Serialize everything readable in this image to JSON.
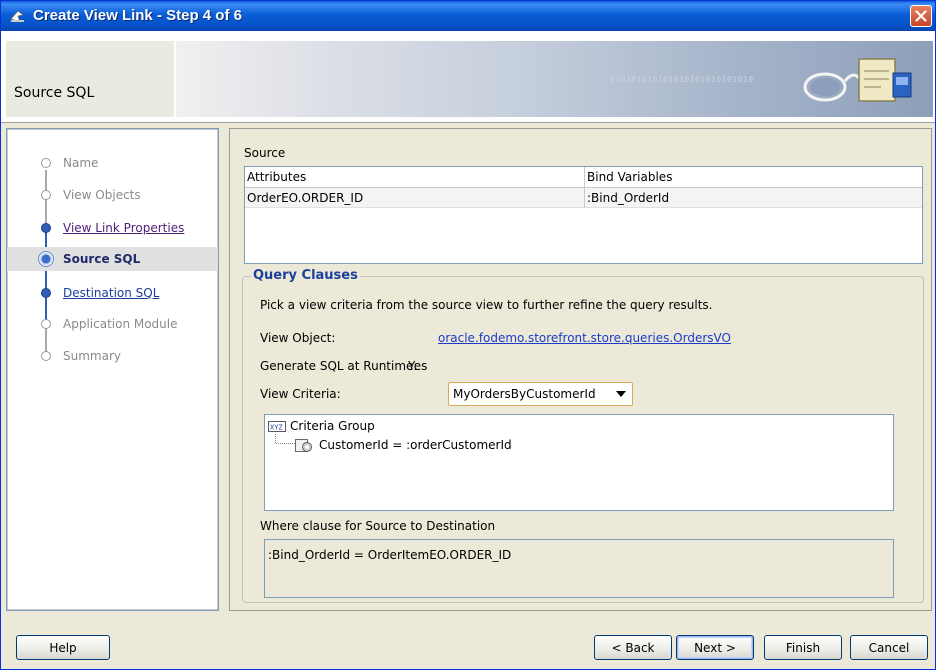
{
  "window": {
    "title": "Create View Link - Step 4 of 6"
  },
  "header": {
    "page_title": "Source SQL",
    "banner_digits": "010101010101010101010101010"
  },
  "steps": [
    {
      "label": "Name",
      "state": "future"
    },
    {
      "label": "View Objects",
      "state": "future"
    },
    {
      "label": "View Link Properties",
      "state": "done"
    },
    {
      "label": "Source SQL",
      "state": "current"
    },
    {
      "label": "Destination SQL",
      "state": "next"
    },
    {
      "label": "Application Module",
      "state": "future"
    },
    {
      "label": "Summary",
      "state": "future"
    }
  ],
  "source": {
    "label": "Source",
    "columns": [
      "Attributes",
      "Bind Variables"
    ],
    "rows": [
      {
        "attribute": "OrderEO.ORDER_ID",
        "bind_variable": ":Bind_OrderId"
      }
    ]
  },
  "query_clauses": {
    "legend": "Query Clauses",
    "description": "Pick a view criteria from the source view to further refine the query results.",
    "view_object_label": "View Object:",
    "view_object_value": "oracle.fodemo.storefront.store.queries.OrdersVO",
    "generate_sql_label": "Generate SQL at Runtime:",
    "generate_sql_value": "Yes",
    "view_criteria_label": "View Criteria:",
    "view_criteria_value": "MyOrdersByCustomerId",
    "tree": {
      "group_label": "Criteria Group",
      "item_label": "CustomerId = :orderCustomerId"
    },
    "where_label": "Where clause for Source to Destination",
    "where_value": ":Bind_OrderId = OrderItemEO.ORDER_ID"
  },
  "buttons": {
    "help": "Help",
    "back": "< Back",
    "next": "Next >",
    "finish": "Finish",
    "cancel": "Cancel"
  },
  "colors": {
    "title_bar": "#0a5ed6",
    "legend_text": "#1a3f9c",
    "link": "#1a3cc8",
    "step_done": "#4d1f7a",
    "step_next": "#1b3fa0"
  }
}
